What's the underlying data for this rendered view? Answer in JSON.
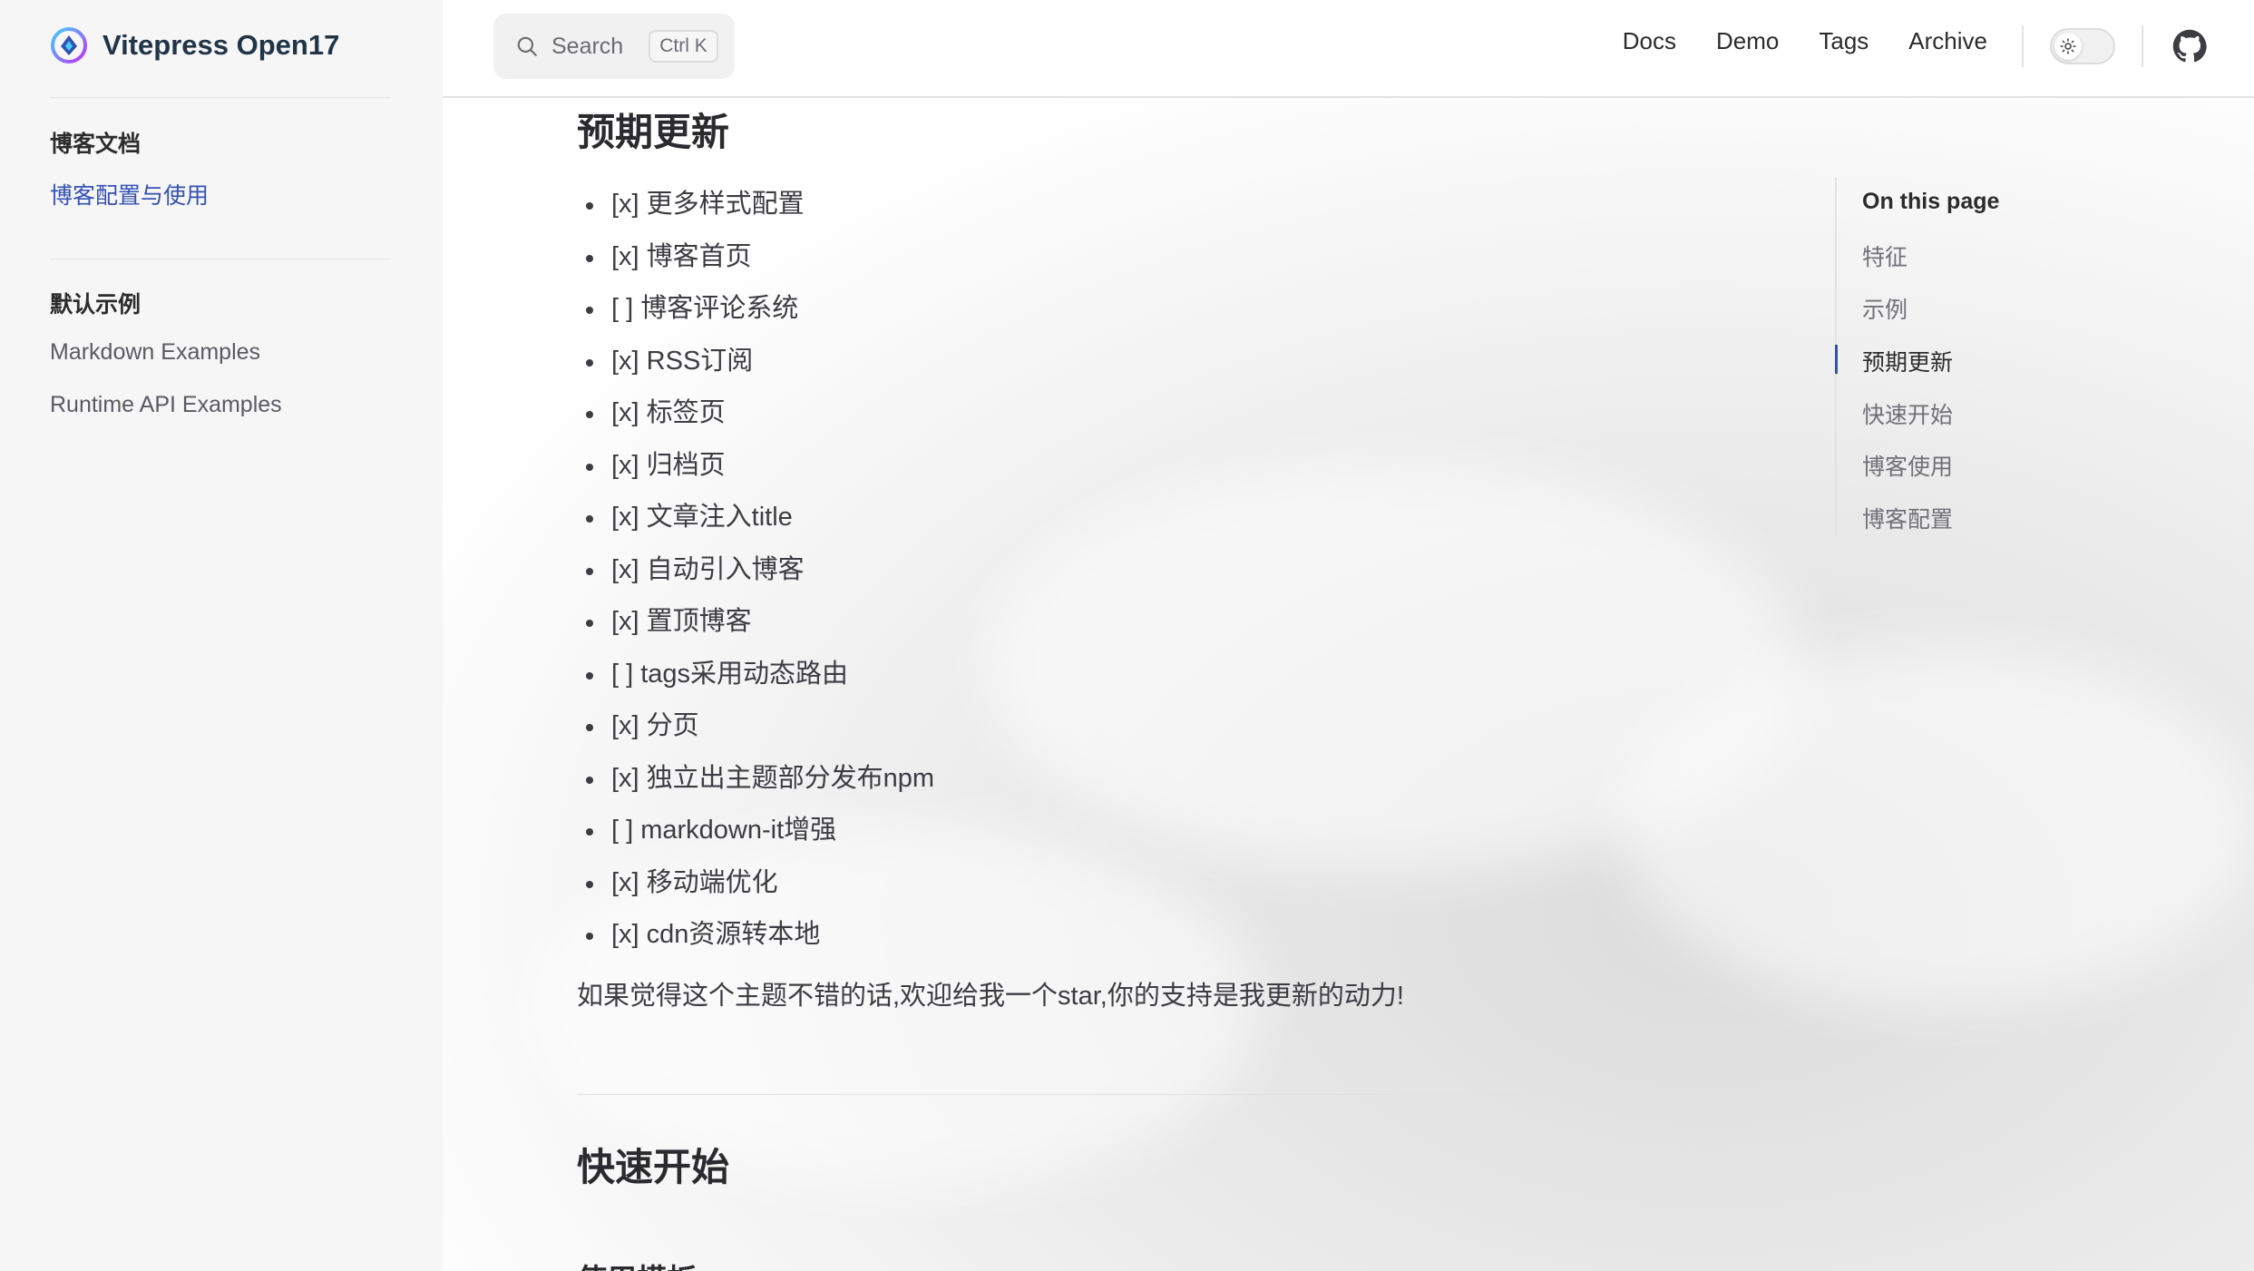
{
  "brand": {
    "title": "Vitepress Open17"
  },
  "search": {
    "placeholder": "Search",
    "shortcut": "Ctrl K"
  },
  "nav": [
    "Docs",
    "Demo",
    "Tags",
    "Archive"
  ],
  "sidebar": {
    "groups": [
      {
        "title": "博客文档",
        "items": [
          {
            "label": "博客配置与使用",
            "active": true
          }
        ]
      },
      {
        "title": "默认示例",
        "items": [
          {
            "label": "Markdown Examples"
          },
          {
            "label": "Runtime API Examples"
          }
        ]
      }
    ]
  },
  "main": {
    "heading": "预期更新",
    "todos": [
      "[x] 更多样式配置",
      "[x] 博客首页",
      "[ ] 博客评论系统",
      "[x] RSS订阅",
      "[x] 标签页",
      "[x] 归档页",
      "[x] 文章注入title",
      "[x] 自动引入博客",
      "[x] 置顶博客",
      "[ ] tags采用动态路由",
      "[x] 分页",
      "[x] 独立出主题部分发布npm",
      "[ ] markdown-it增强",
      "[x] 移动端优化",
      "[x] cdn资源转本地"
    ],
    "paragraph": "如果觉得这个主题不错的话,欢迎给我一个star,你的支持是我更新的动力!",
    "heading2": "快速开始",
    "heading3": "使用模板"
  },
  "outline": {
    "title": "On this page",
    "items": [
      "特征",
      "示例",
      "预期更新",
      "快速开始",
      "博客使用",
      "博客配置"
    ],
    "active_index": 2
  },
  "colors": {
    "accent": "#3451b2",
    "sidebar_bg": "#f6f6f7"
  }
}
